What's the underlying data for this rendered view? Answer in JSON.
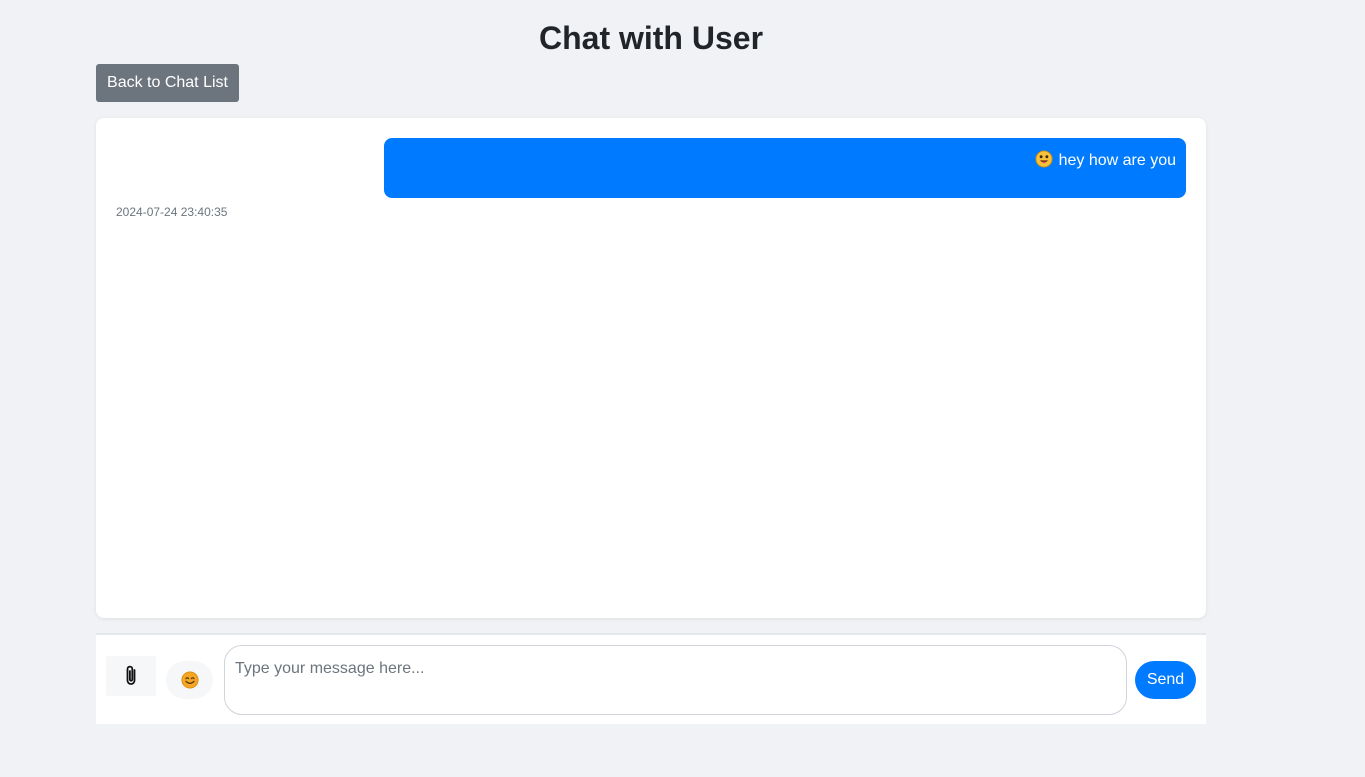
{
  "header": {
    "title": "Chat with User",
    "back_label": "Back to Chat List"
  },
  "messages": [
    {
      "text": "hey how are you",
      "emoji_icon": "tongue-out-face-icon",
      "timestamp": "2024-07-24 23:40:35",
      "sender": "self"
    }
  ],
  "composer": {
    "attach_icon": "paperclip-icon",
    "emoji_icon": "smiley-face-icon",
    "placeholder": "Type your message here...",
    "value": "",
    "send_label": "Send"
  },
  "colors": {
    "primary": "#007bff",
    "secondary": "#6c757d",
    "background": "#f0f2f5"
  }
}
